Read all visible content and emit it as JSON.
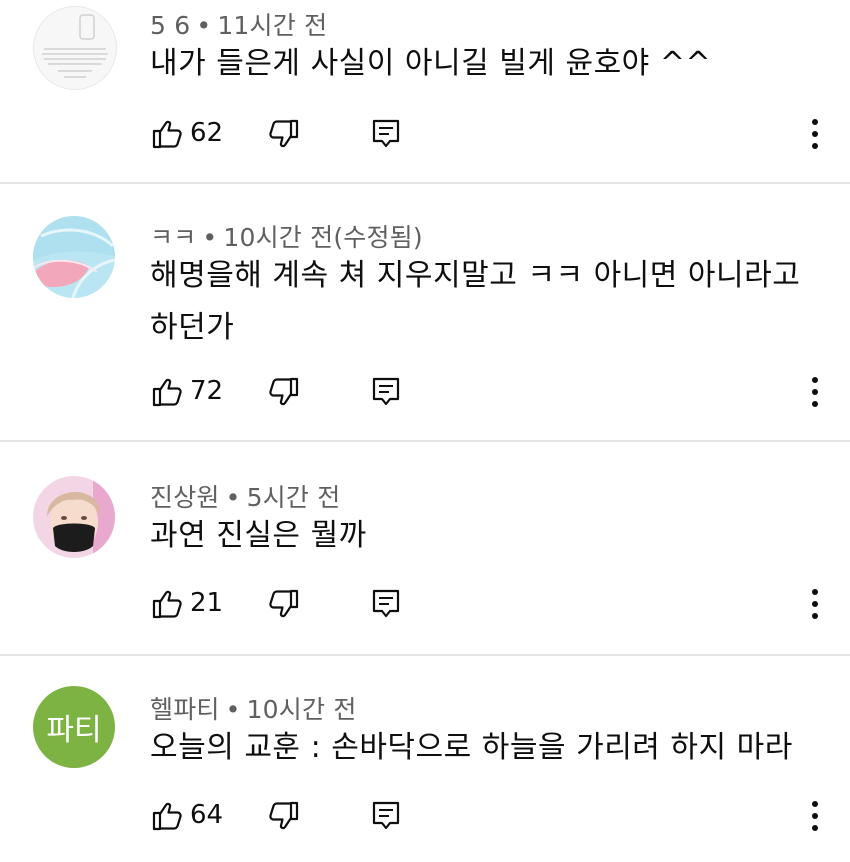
{
  "comments": [
    {
      "author": "5 6",
      "time": "11시간 전",
      "text": "내가 들은게 사실이 아니길 빌게 윤호야 ^^",
      "likes": "62",
      "avatar": "avatar-note-image-icon"
    },
    {
      "author": "ㅋㅋ",
      "time": "10시간 전(수정됨)",
      "text": "해명을해 계속 쳐 지우지말고 ㅋㅋ 아니면 아니라고 하던가",
      "likes": "72",
      "avatar": "avatar-pastel-circle-icon"
    },
    {
      "author": "진상원",
      "time": "5시간 전",
      "text": "과연 진실은 뭘까",
      "likes": "21",
      "avatar": "avatar-person-mask-icon"
    },
    {
      "author": "헬파티",
      "time": "10시간 전",
      "text": "오늘의 교훈 : 손바닥으로 하늘을 가리려 하지 마라",
      "likes": "64",
      "avatar_text": "파티",
      "avatar_color": "#7cb342"
    }
  ],
  "icons": {
    "like": "thumbs-up-icon",
    "dislike": "thumbs-down-icon",
    "reply": "reply-icon",
    "more": "more-vert-icon"
  }
}
